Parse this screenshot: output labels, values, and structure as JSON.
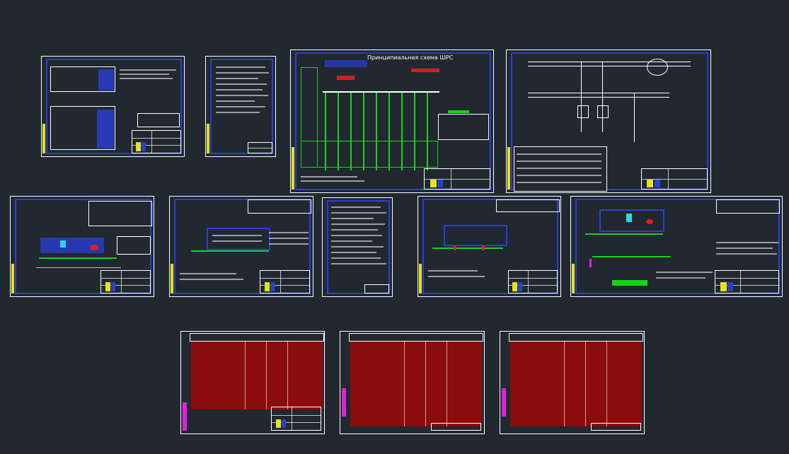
{
  "viewport": {
    "background": "#212830"
  },
  "sheets": [
    {
      "id": "cover-list",
      "title": ""
    },
    {
      "id": "general-notes",
      "title": ""
    },
    {
      "id": "schematic",
      "title": "Принципиальная схема ШРС"
    },
    {
      "id": "wiring",
      "title": ""
    },
    {
      "id": "plan-1",
      "title": ""
    },
    {
      "id": "plan-2",
      "title": ""
    },
    {
      "id": "notes-2",
      "title": ""
    },
    {
      "id": "plan-3",
      "title": ""
    },
    {
      "id": "plan-4",
      "title": ""
    },
    {
      "id": "spec-1",
      "title": ""
    },
    {
      "id": "spec-2",
      "title": ""
    },
    {
      "id": "spec-3",
      "title": ""
    }
  ],
  "colors": {
    "frame": "#2a3fd6",
    "border": "#ffffff",
    "stamp_accent": "#e8e020",
    "cable": "#16d41a",
    "table_fill": "#8b0c0c",
    "equipment": "#2ad8e8",
    "marker": "#e020e0"
  }
}
